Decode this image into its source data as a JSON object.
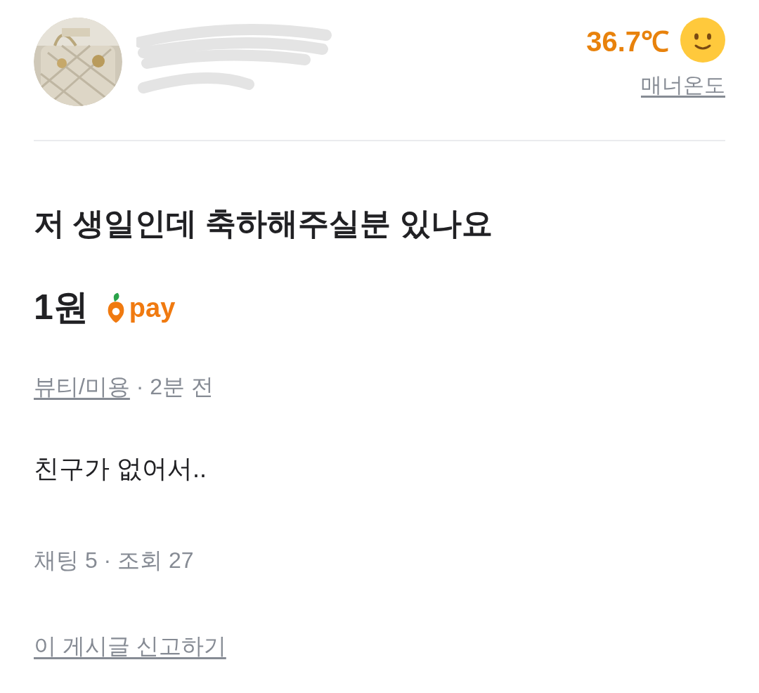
{
  "profile": {
    "temperature": "36.7℃",
    "temperature_label": "매너온도"
  },
  "post": {
    "title": "저 생일인데 축하해주실분 있나요",
    "price": "1원",
    "pay_badge": "pay",
    "category": "뷰티/미용",
    "time": "· 2분 전",
    "body": "친구가 없어서..",
    "stats": "채팅 5 · 조회 27",
    "report_link": "이 게시글 신고하기"
  }
}
